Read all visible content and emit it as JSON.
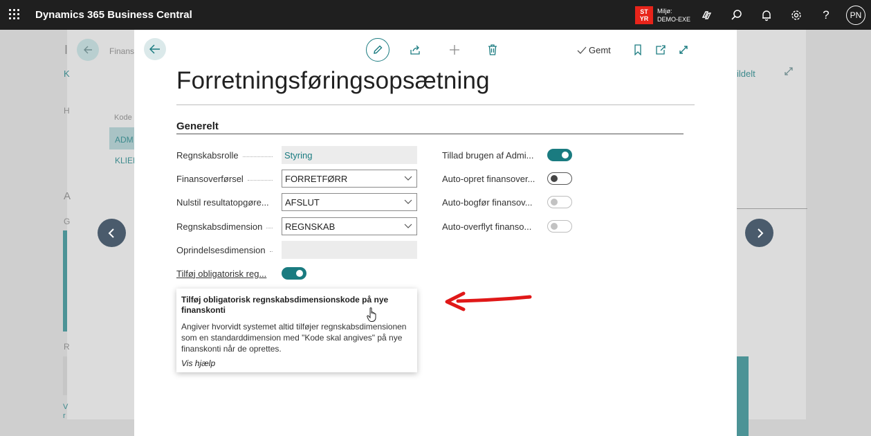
{
  "topbar": {
    "app_title": "Dynamics 365 Business Central",
    "env_badge_line1": "ST",
    "env_badge_line2": "YR",
    "env_label": "Miljø:",
    "env_name": "DEMO-EXE",
    "avatar_initials": "PN",
    "icons": [
      "waffle-icon",
      "copilot-icon",
      "search-icon",
      "bell-icon",
      "gear-icon",
      "help-icon"
    ]
  },
  "background": {
    "breadcrumb": "Finans",
    "col_header": "Kode",
    "row1": "ADM",
    "row2": "KLIEN",
    "fragment_h": "H",
    "fragment_a": "A",
    "fragment_g": "G",
    "fragment_r": "R",
    "fragment_k": "K",
    "fragment_vl": "V",
    "fragment_rl": "r",
    "right_text": "ildelt"
  },
  "dialog": {
    "saved_label": "Gemt",
    "page_title": "Forretningsføringsopsætning",
    "section_title": "Generelt",
    "left_fields": [
      {
        "label": "Regnskabsrolle",
        "value": "Styring",
        "kind": "readonly"
      },
      {
        "label": "Finansoverførsel",
        "value": "FORRETFØRR",
        "kind": "select"
      },
      {
        "label": "Nulstil resultatopgøre...",
        "value": "AFSLUT",
        "kind": "select"
      },
      {
        "label": "Regnskabsdimension",
        "value": "REGNSKAB",
        "kind": "select"
      },
      {
        "label": "Oprindelsesdimension",
        "value": "",
        "kind": "readonly"
      },
      {
        "label": "Tilføj obligatorisk reg...",
        "value": "on",
        "kind": "toggle"
      }
    ],
    "right_fields": [
      {
        "label": "Tillad brugen af Admi...",
        "state": "on"
      },
      {
        "label": "Auto-opret finansover...",
        "state": "off"
      },
      {
        "label": "Auto-bogfør finansov...",
        "state": "disabled"
      },
      {
        "label": "Auto-overflyt finanso...",
        "state": "disabled"
      }
    ]
  },
  "tooltip": {
    "title": "Tilføj obligatorisk regnskabsdimensionskode på nye finanskonti",
    "body": "Angiver hvorvidt systemet altid tilføjer regnskabsdimensionen som en standarddimension med \"Kode skal angives\" på nye finanskonti når de oprettes.",
    "link": "Vis hjælp"
  },
  "colors": {
    "accent": "#1a7b80",
    "topbar": "#1f1f1f",
    "env_badge": "#e8241a",
    "arrow": "#e01818"
  }
}
